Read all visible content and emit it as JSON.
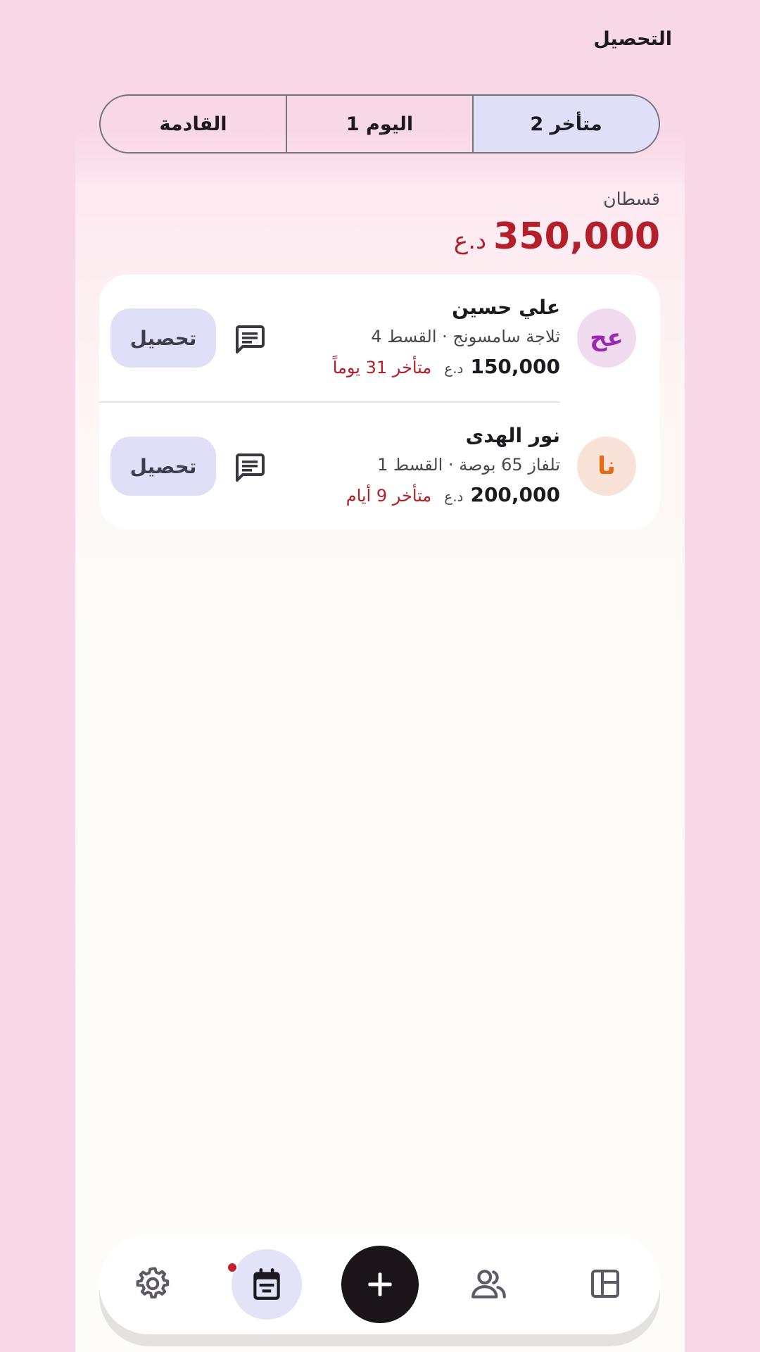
{
  "header": {
    "title": "التحصيل"
  },
  "tabs": [
    {
      "label": "متأخر 2",
      "active": true
    },
    {
      "label": "اليوم 1",
      "active": false
    },
    {
      "label": "القادمة",
      "active": false
    }
  ],
  "summary": {
    "label": "قسطان",
    "amount": "350,000",
    "currency": "د.ع"
  },
  "items": [
    {
      "initials": "عح",
      "avatar_color": "#9c27b0",
      "avatar_bg": "#f1dcef",
      "name": "علي حسين",
      "description": "ثلاجة سامسونج · القسط 4",
      "amount": "150,000",
      "currency": "د.ع",
      "late": "متأخر 31 يوماً",
      "action": "تحصيل"
    },
    {
      "initials": "نا",
      "avatar_color": "#e8690f",
      "avatar_bg": "#f9e2d8",
      "name": "نور الهدى",
      "description": "تلفاز 65 بوصة · القسط 1",
      "amount": "200,000",
      "currency": "د.ع",
      "late": "متأخر 9 أيام",
      "action": "تحصيل"
    }
  ],
  "nav": {
    "icons": [
      "settings-icon",
      "collection-calendar-icon",
      "plus-icon",
      "customers-icon",
      "dashboard-icon"
    ],
    "active": "collection-calendar-icon",
    "notification_dot": true
  },
  "colors": {
    "accent_red": "#b3202c",
    "selected_bg": "#dfe0f7",
    "page_bg": "#f8d7e7"
  }
}
